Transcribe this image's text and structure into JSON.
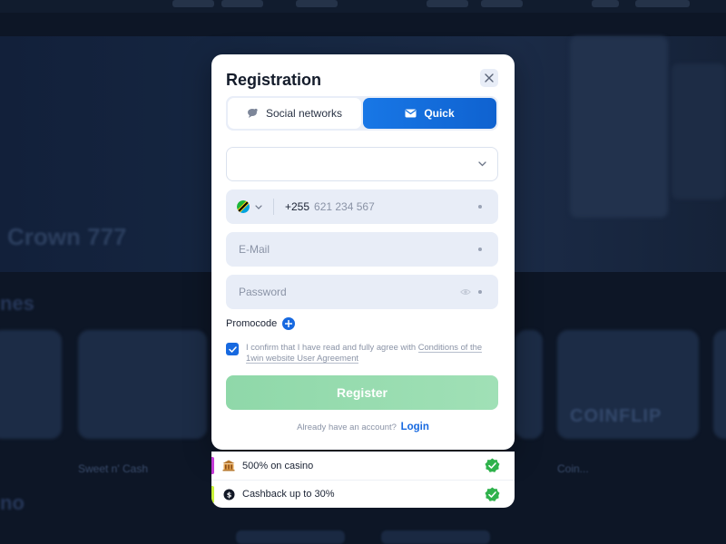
{
  "modal": {
    "title": "Registration",
    "tabs": [
      {
        "label": "Social networks",
        "icon": "chat-bubble-icon",
        "active": false
      },
      {
        "label": "Quick",
        "icon": "envelope-icon",
        "active": true
      }
    ],
    "currency_select": {
      "value": ""
    },
    "phone": {
      "country_flag": "tanzania-flag-icon",
      "code": "+255",
      "placeholder": "621 234 567"
    },
    "email": {
      "placeholder": "E-Mail"
    },
    "password": {
      "placeholder": "Password"
    },
    "promocode_label": "Promocode",
    "agreement": {
      "checked": true,
      "text": "I confirm that I have read and fully agree with ",
      "link": "Conditions of the 1win website User Agreement"
    },
    "register_label": "Register",
    "login_prompt": "Already have an account?",
    "login_link": "Login"
  },
  "bonuses": [
    {
      "label": "500% on casino",
      "icon": "casino-icon",
      "accent": "#c43bd6",
      "checked": true
    },
    {
      "label": "Cashback up to 30%",
      "icon": "cashback-icon",
      "accent": "#c9f23a",
      "checked": true
    }
  ],
  "background": {
    "title": "Crown 777",
    "section1": "nes",
    "section2": "no",
    "card_labels": [
      "Sweet n' Cash",
      "Coin..."
    ],
    "card_text": "COINFLIP"
  },
  "colors": {
    "primary": "#1769e0",
    "register": "#9adcb2",
    "check": "#2fb24c"
  }
}
